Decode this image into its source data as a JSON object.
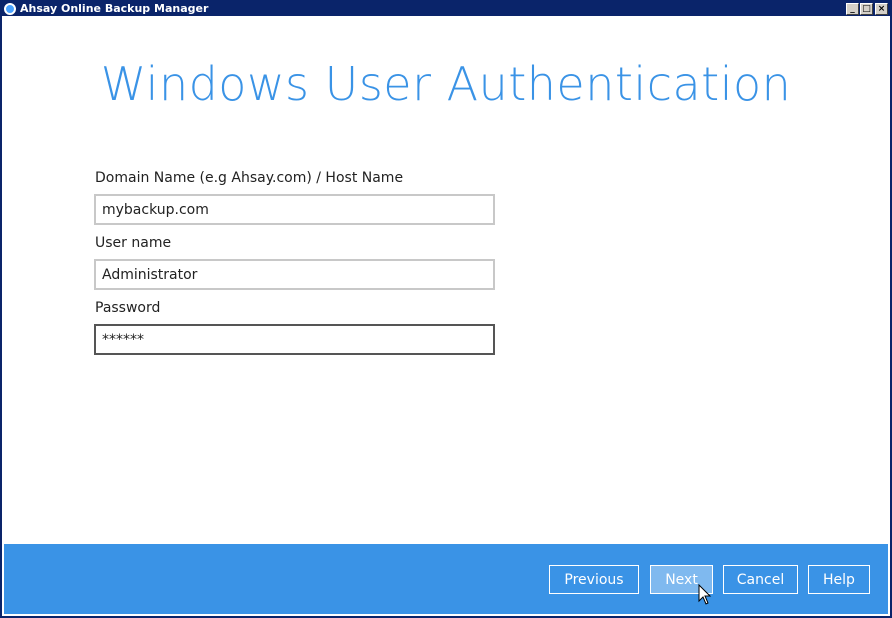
{
  "window": {
    "title": "Ahsay Online Backup Manager",
    "controls": {
      "minimize": "_",
      "maximize": "□",
      "close": "×"
    }
  },
  "page": {
    "heading": "Windows User Authentication"
  },
  "form": {
    "domain": {
      "label": "Domain Name (e.g Ahsay.com) / Host Name",
      "value": "mybackup.com"
    },
    "username": {
      "label": "User name",
      "value": "Administrator"
    },
    "password": {
      "label": "Password",
      "value": "******"
    }
  },
  "footer": {
    "previous_label": "Previous",
    "next_label": "Next",
    "cancel_label": "Cancel",
    "help_label": "Help"
  },
  "colors": {
    "accent": "#3a93e6",
    "titlebar": "#0a246a",
    "next_button_highlight": "#7fb9ef"
  },
  "icons": {
    "app": "ahsay-app-icon",
    "cursor": "mouse-pointer-icon"
  }
}
